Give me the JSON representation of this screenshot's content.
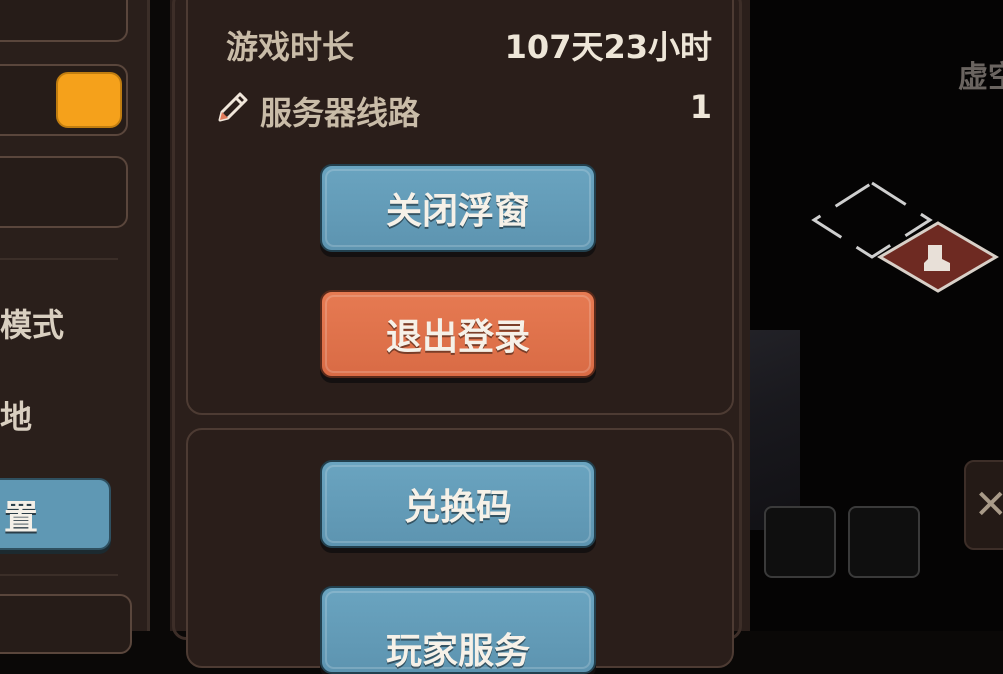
{
  "info": {
    "play_time_label": "游戏时长",
    "play_time_value": "107天23小时",
    "server_label": "服务器线路",
    "server_value": "1"
  },
  "buttons": {
    "close_float": "关闭浮窗",
    "logout": "退出登录",
    "redeem_code": "兑换码",
    "player_service": "玩家服务"
  },
  "left_panel": {
    "mode_text": "模式",
    "place_text": "地",
    "settings_button": "置",
    "toggle_state": "on"
  },
  "scene": {
    "region_label": "虚空"
  },
  "colors": {
    "panel_bg": "#2b1f1b",
    "blue_button": "#5f98b4",
    "orange_button": "#d96b45",
    "toggle_on": "#f5a11b"
  }
}
